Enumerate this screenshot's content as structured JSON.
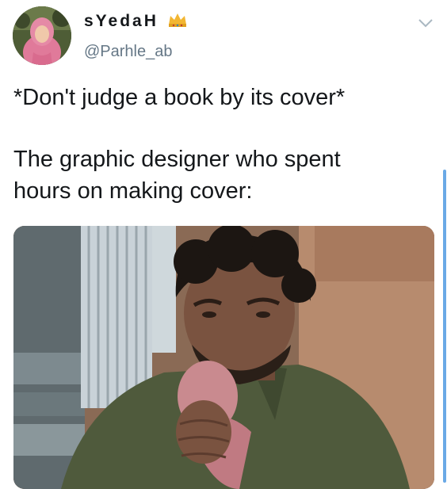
{
  "tweet": {
    "display_name": "sYedaH",
    "crown_icon": "crown-emoji",
    "handle": "@Parhle_ab",
    "menu_icon": "chevron-down-icon",
    "text_line_1": "*Don't judge a book by its cover*",
    "text_line_2": "The graphic designer who spent",
    "text_line_3": "hours on making cover:"
  },
  "colors": {
    "text": "#14171a",
    "secondary_text": "#657786",
    "accent": "#6aa9e6"
  }
}
